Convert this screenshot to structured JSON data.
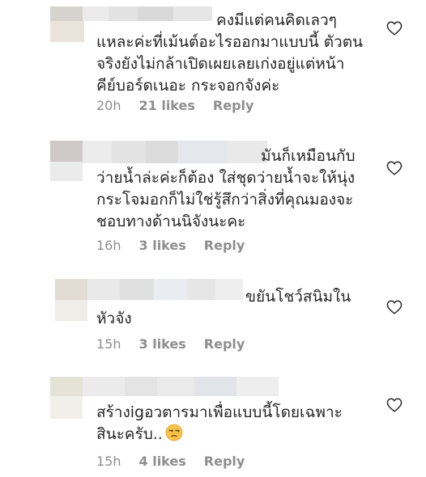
{
  "comments": [
    {
      "text_lines": "คงมีแต่คนคิดเลวๆ\nแหละค่ะที่เม้นต์อะไรออกมาแบบนี้ ตัวตน\nจริงยังไม่กล้าเปิดเผยเลยเก่งอยู่แต่หน้า\nคีย์บอร์ดเนอะ กระจอกจังค่ะ",
      "time": "20h",
      "likes": "21 likes",
      "reply": "Reply"
    },
    {
      "text_lines": "มันก็เหมือนกับ\nว่ายน้ำล่ะค่ะก็ต้อง ใส่ชุดว่ายน้ำจะให้นุ่ง\nกระโจมอกก็ไม่ใช่รู้สึกว่าสิ่งที่คุณมองจะ\nชอบทางด้านนิจังนะคะ",
      "time": "16h",
      "likes": "3 likes",
      "reply": "Reply"
    },
    {
      "text_lines": "ขยันโชว์สนิมใน\nหัวจัง",
      "time": "15h",
      "likes": "3 likes",
      "reply": "Reply"
    },
    {
      "text_lines": "สร้างigอวตารมาเพื่อแบบนี้โดยเฉพาะ\nสินะครับ..",
      "time": "15h",
      "likes": "4 likes",
      "reply": "Reply"
    }
  ],
  "icons": {
    "like": "heart-outline-icon",
    "emoji": "unamused-face-emoji"
  }
}
